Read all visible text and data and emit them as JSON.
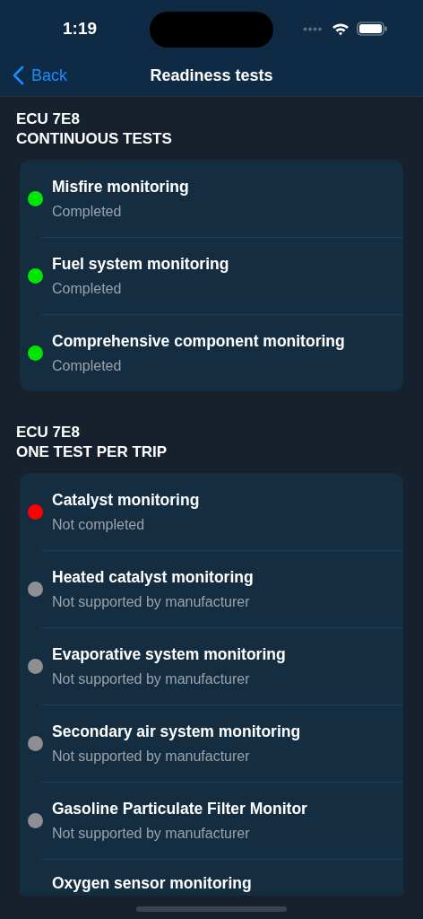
{
  "status_bar": {
    "time": "1:19"
  },
  "nav": {
    "back": "Back",
    "title": "Readiness tests"
  },
  "sections": [
    {
      "ecu": "ECU 7E8",
      "title": "CONTINUOUS TESTS",
      "tests": [
        {
          "name": "Misfire monitoring",
          "status": "Completed",
          "color": "#00e600"
        },
        {
          "name": "Fuel system monitoring",
          "status": "Completed",
          "color": "#00e600"
        },
        {
          "name": "Comprehensive component monitoring",
          "status": "Completed",
          "color": "#00e600"
        }
      ]
    },
    {
      "ecu": "ECU 7E8",
      "title": "ONE TEST PER TRIP",
      "tests": [
        {
          "name": "Catalyst monitoring",
          "status": "Not completed",
          "color": "#ff0000"
        },
        {
          "name": "Heated catalyst monitoring",
          "status": "Not supported by manufacturer",
          "color": "#8e8e93"
        },
        {
          "name": "Evaporative system monitoring",
          "status": "Not supported by manufacturer",
          "color": "#8e8e93"
        },
        {
          "name": "Secondary air system monitoring",
          "status": "Not supported by manufacturer",
          "color": "#8e8e93"
        },
        {
          "name": "Gasoline Particulate Filter Monitor",
          "status": "Not supported by manufacturer",
          "color": "#8e8e93"
        },
        {
          "name": "Oxygen sensor monitoring"
        }
      ]
    }
  ]
}
